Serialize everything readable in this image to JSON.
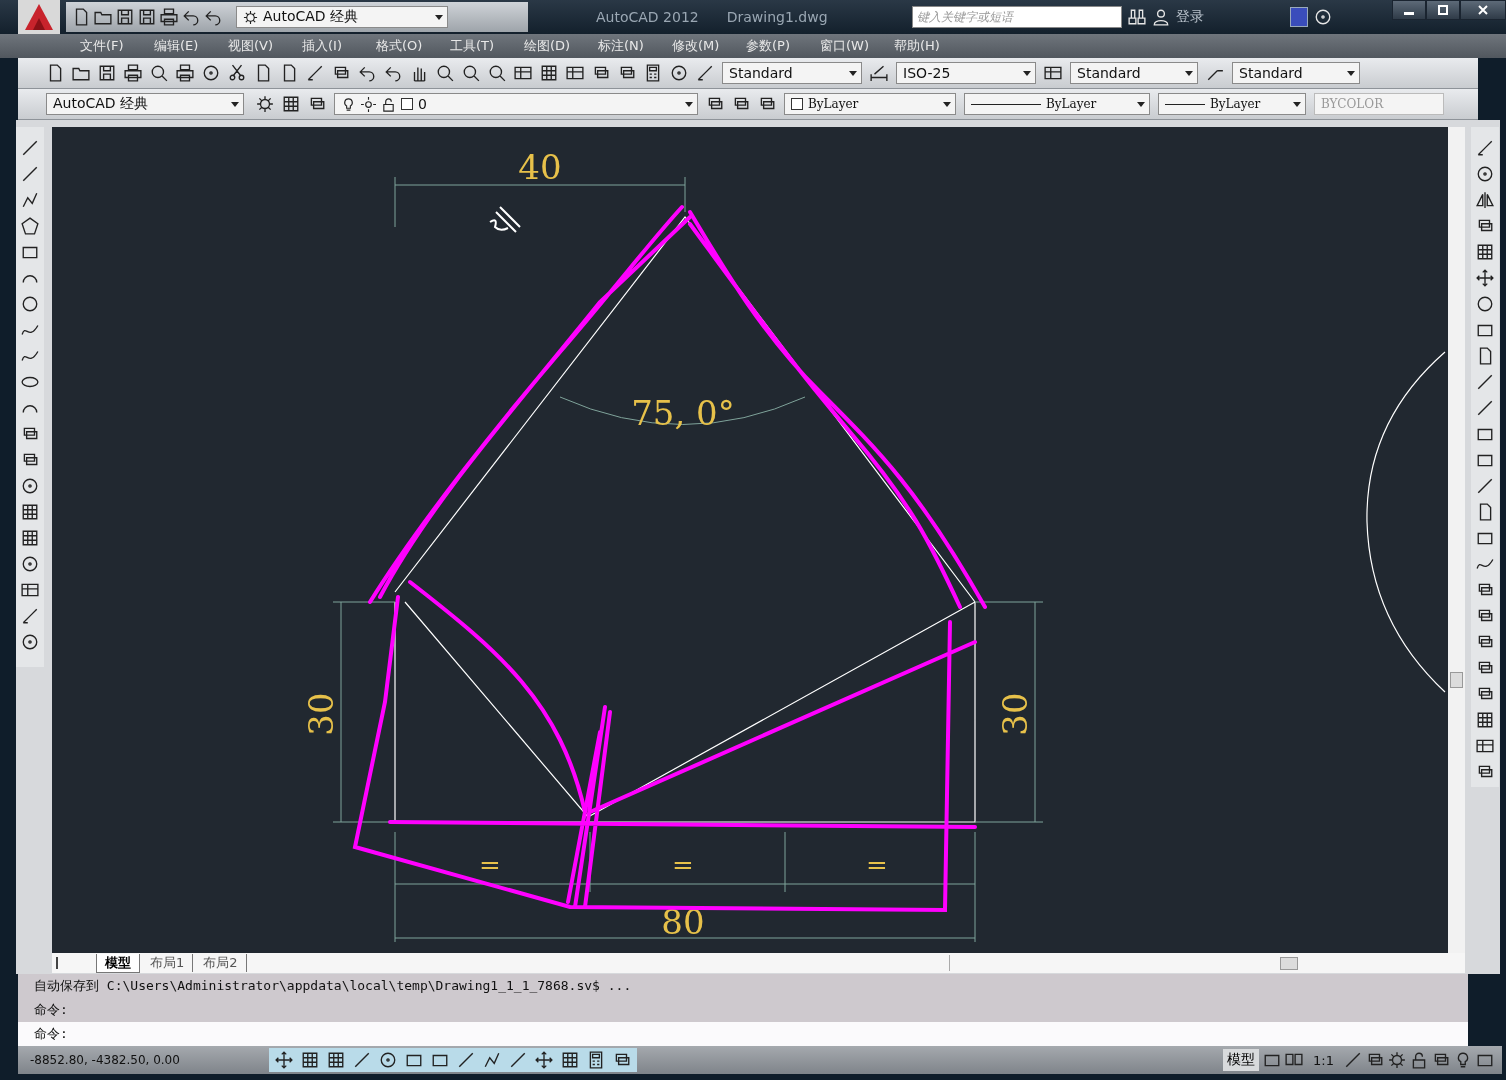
{
  "title_bar": {
    "workspace": "AutoCAD 经典",
    "app_title": "AutoCAD 2012",
    "file_name": "Drawing1.dwg",
    "search": {
      "placeholder": "键入关键字或短语"
    },
    "sign_in": "登录"
  },
  "menu_bar": [
    "文件(F)",
    "编辑(E)",
    "视图(V)",
    "插入(I)",
    "格式(O)",
    "工具(T)",
    "绘图(D)",
    "标注(N)",
    "修改(M)",
    "参数(P)",
    "窗口(W)",
    "帮助(H)"
  ],
  "styles_toolbar": {
    "text_style": "Standard",
    "dim_style": "ISO-25",
    "table_style": "Standard",
    "multileader_style": "Standard"
  },
  "properties_toolbar": {
    "workspace": "AutoCAD 经典",
    "layer": "0",
    "object_color_setting": "ByLayer",
    "linetype": "ByLayer",
    "lineweight": "ByLayer",
    "plot_style": "BYCOLOR"
  },
  "drawing": {
    "dimension_labels": [
      "40",
      "75, 0°",
      "30",
      "30",
      "=",
      "=",
      "=",
      "80"
    ]
  },
  "layout_tabs": [
    {
      "label": "模型",
      "selected": true
    },
    {
      "label": "布局1",
      "selected": false
    },
    {
      "label": "布局2",
      "selected": false
    }
  ],
  "command_lines": [
    "自动保存到 C:\\Users\\Administrator\\appdata\\local\\temp\\Drawing1_1_1_7868.sv$ ...",
    "命令:",
    "命令:"
  ],
  "status_bar": {
    "coordinates": "-8852.80, -4382.50, 0.00",
    "model_button": "模型",
    "annotation_scale": "1:1"
  }
}
